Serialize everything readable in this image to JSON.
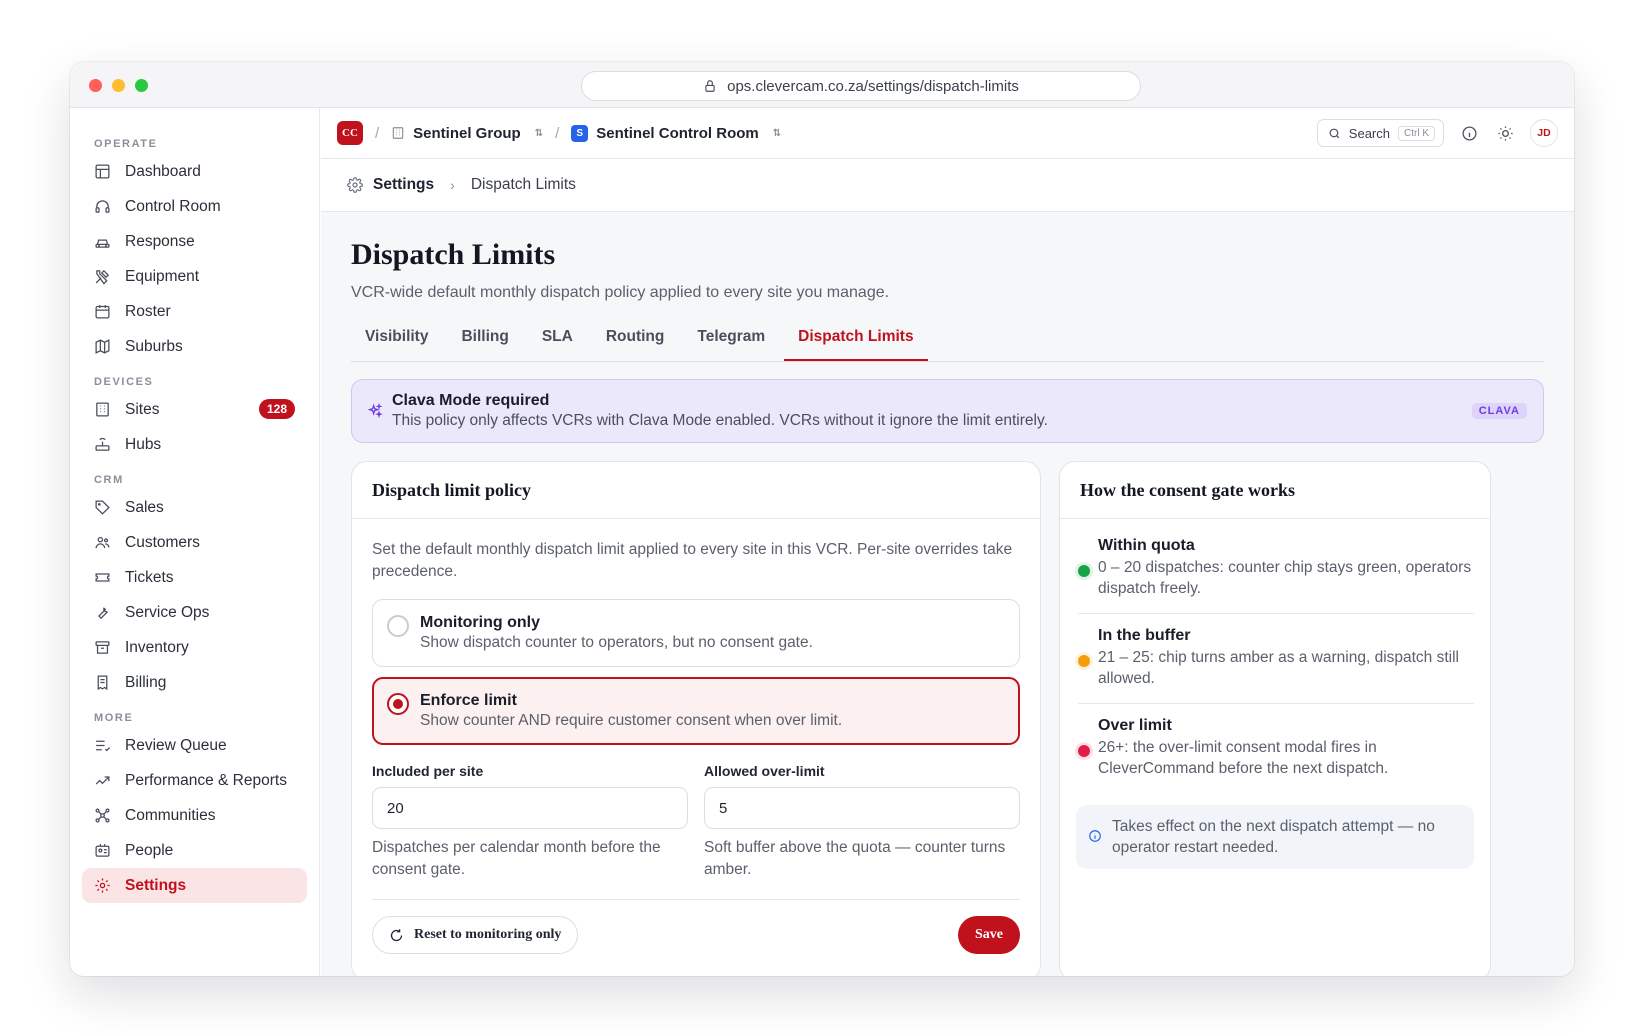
{
  "browser": {
    "url": "ops.clevercam.co.za/settings/dispatch-limits"
  },
  "sidebar": {
    "sections": [
      {
        "title": "OPERATE",
        "items": [
          {
            "label": "Dashboard",
            "icon": "layout-icon"
          },
          {
            "label": "Control Room",
            "icon": "headset-icon"
          },
          {
            "label": "Response",
            "icon": "car-icon"
          },
          {
            "label": "Equipment",
            "icon": "tools-icon"
          },
          {
            "label": "Roster",
            "icon": "calendar-icon"
          },
          {
            "label": "Suburbs",
            "icon": "map-icon"
          }
        ]
      },
      {
        "title": "DEVICES",
        "items": [
          {
            "label": "Sites",
            "icon": "building-icon",
            "badge": "128"
          },
          {
            "label": "Hubs",
            "icon": "router-icon"
          }
        ]
      },
      {
        "title": "CRM",
        "items": [
          {
            "label": "Sales",
            "icon": "tag-icon"
          },
          {
            "label": "Customers",
            "icon": "users-icon"
          },
          {
            "label": "Tickets",
            "icon": "ticket-icon"
          },
          {
            "label": "Service Ops",
            "icon": "wrench-icon"
          },
          {
            "label": "Inventory",
            "icon": "archive-icon"
          },
          {
            "label": "Billing",
            "icon": "receipt-icon"
          }
        ]
      },
      {
        "title": "MORE",
        "items": [
          {
            "label": "Review Queue",
            "icon": "list-check-icon"
          },
          {
            "label": "Performance & Reports",
            "icon": "trend-icon"
          },
          {
            "label": "Communities",
            "icon": "network-icon"
          },
          {
            "label": "People",
            "icon": "id-card-icon"
          },
          {
            "label": "Settings",
            "icon": "gear-icon",
            "active": true
          }
        ]
      }
    ]
  },
  "topbar": {
    "logo": "CC",
    "org": "Sentinel Group",
    "room_logo": "S",
    "room": "Sentinel Control Room",
    "search_label": "Search",
    "search_shortcut": "Ctrl K",
    "avatar": "JD"
  },
  "subbar": {
    "section": "Settings",
    "page": "Dispatch Limits"
  },
  "page": {
    "title": "Dispatch Limits",
    "subtitle": "VCR-wide default monthly dispatch policy applied to every site you manage.",
    "tabs": [
      "Visibility",
      "Billing",
      "SLA",
      "Routing",
      "Telegram",
      "Dispatch Limits"
    ],
    "active_tab": "Dispatch Limits"
  },
  "banner": {
    "title": "Clava Mode required",
    "text": "This policy only affects VCRs with Clava Mode enabled. VCRs without it ignore the limit entirely.",
    "pill": "CLAVA"
  },
  "policy": {
    "title": "Dispatch limit policy",
    "description": "Set the default monthly dispatch limit applied to every site in this VCR. Per-site overrides take precedence.",
    "options": [
      {
        "title": "Monitoring only",
        "text": "Show dispatch counter to operators, but no consent gate.",
        "selected": false
      },
      {
        "title": "Enforce limit",
        "text": "Show counter AND require customer consent when over limit.",
        "selected": true
      }
    ],
    "included": {
      "label": "Included per site",
      "value": "20",
      "hint": "Dispatches per calendar month before the consent gate."
    },
    "overlimit": {
      "label": "Allowed over-limit",
      "value": "5",
      "hint": "Soft buffer above the quota — counter turns amber."
    },
    "reset_label": "Reset to monitoring only",
    "save_label": "Save"
  },
  "gate": {
    "title": "How the consent gate works",
    "items": [
      {
        "title": "Within quota",
        "text": "0 – 20 dispatches: counter chip stays green, operators dispatch freely.",
        "color": "#16a34a"
      },
      {
        "title": "In the buffer",
        "text": "21 – 25: chip turns amber as a warning, dispatch still allowed.",
        "color": "#f59e0b"
      },
      {
        "title": "Over limit",
        "text": "26+: the over-limit consent modal fires in CleverCommand before the next dispatch.",
        "color": "#e11d48"
      }
    ],
    "note": "Takes effect on the next dispatch attempt — no operator restart needed."
  },
  "colors": {
    "accent": "#c0121d",
    "clava": "#6d3fe0"
  }
}
